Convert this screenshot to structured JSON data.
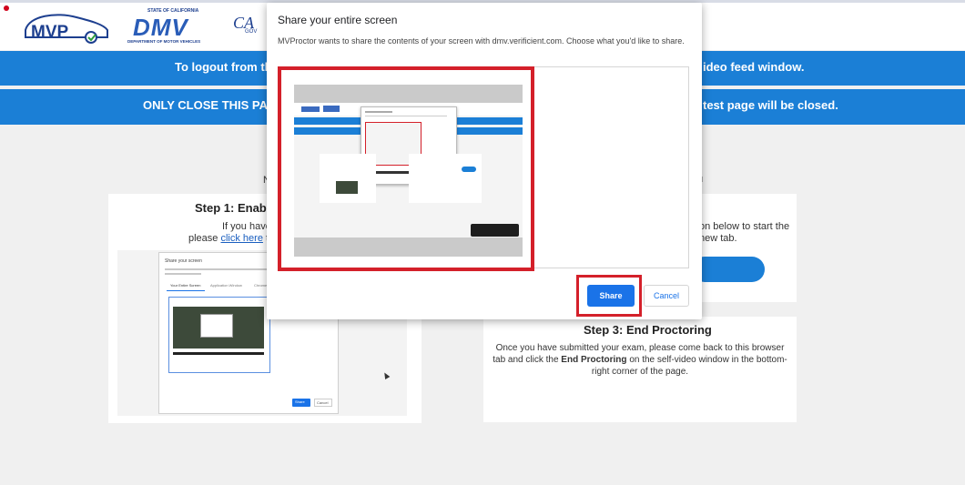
{
  "header": {
    "mvp_logo": "MVP",
    "dmv_logo_top": "STATE OF CALIFORNIA",
    "dmv_logo": "DMV",
    "dmv_logo_bottom": "DEPARTMENT OF MOTOR VEHICLES",
    "ca_logo": "CA",
    "ca_gov": "GOV"
  },
  "banners": {
    "logout_left": "To logout from the",
    "logout_right": "ideo feed window.",
    "close_left": "ONLY CLOSE THIS PAGE",
    "close_right": "test page will be closed."
  },
  "step1": {
    "title": "Step 1: Enable",
    "line1": "If you have",
    "line2_pre": "please",
    "link": "click here",
    "line2_post": "to"
  },
  "step2": {
    "line1": "on below to start the",
    "line2": "new tab."
  },
  "step3": {
    "title": "Step 3: End Proctoring",
    "text_1": "Once you have submitted your exam, please come back to this browser tab and click the",
    "text_bold": "End Proctoring",
    "text_2": "on the self-video window in the bottom-right corner of the page."
  },
  "partial_heading_left": "N",
  "partial_heading_right": "u",
  "dialog": {
    "title": "Share your entire screen",
    "description": "MVProctor wants to share the contents of your screen with dmv.verificient.com. Choose what you'd like to share.",
    "share_label": "Share",
    "cancel_label": "Cancel"
  },
  "background_screenshot": {
    "dialog_title": "Share your screen",
    "tabs": [
      "Your Entire Screen",
      "Application Window",
      "Chrome Tab"
    ],
    "share_label": "Share",
    "cancel_label": "Cancel"
  },
  "colors": {
    "banner_blue": "#1b7fd6",
    "highlight_red": "#d4202a",
    "share_blue": "#1a73e8"
  }
}
